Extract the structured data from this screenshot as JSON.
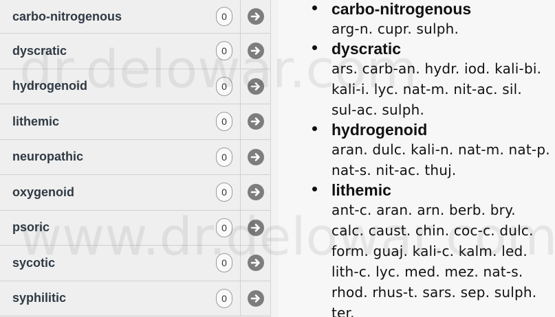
{
  "left_list": {
    "items": [
      {
        "label": "carbo-nitrogenous",
        "count": "0"
      },
      {
        "label": "dyscratic",
        "count": "0"
      },
      {
        "label": "hydrogenoid",
        "count": "0"
      },
      {
        "label": "lithemic",
        "count": "0"
      },
      {
        "label": "neuropathic",
        "count": "0"
      },
      {
        "label": "oxygenoid",
        "count": "0"
      },
      {
        "label": "psoric",
        "count": "0"
      },
      {
        "label": "sycotic",
        "count": "0"
      },
      {
        "label": "syphilitic",
        "count": "0"
      }
    ],
    "go_icon": "arrow-right-circle-icon"
  },
  "right_panel": {
    "entries": [
      {
        "rubric": "carbo-nitrogenous",
        "remedies": "arg-n. cupr. sulph."
      },
      {
        "rubric": "dyscratic",
        "remedies": "ars. carb-an. hydr. iod. kali-bi. kali-i. lyc. nat-m. nit-ac. sil. sul-ac. sulph."
      },
      {
        "rubric": "hydrogenoid",
        "remedies": "aran. dulc. kali-n. nat-m. nat-p. nat-s. nit-ac. thuj."
      },
      {
        "rubric": "lithemic",
        "remedies": "ant-c. aran. arn. berb. bry. calc. caust. chin. coc-c. dulc. form. guaj. kali-c. kalm. led. lith-c. lyc. med. mez. nat-s. rhod. rhus-t. sars. sep. sulph. ter."
      }
    ]
  },
  "watermark": {
    "text_top": "dr.delowar.com",
    "text_bottom": "www.dr.delowar.com"
  },
  "colors": {
    "icon": "#7d7d7d",
    "label": "#2f3a44"
  }
}
